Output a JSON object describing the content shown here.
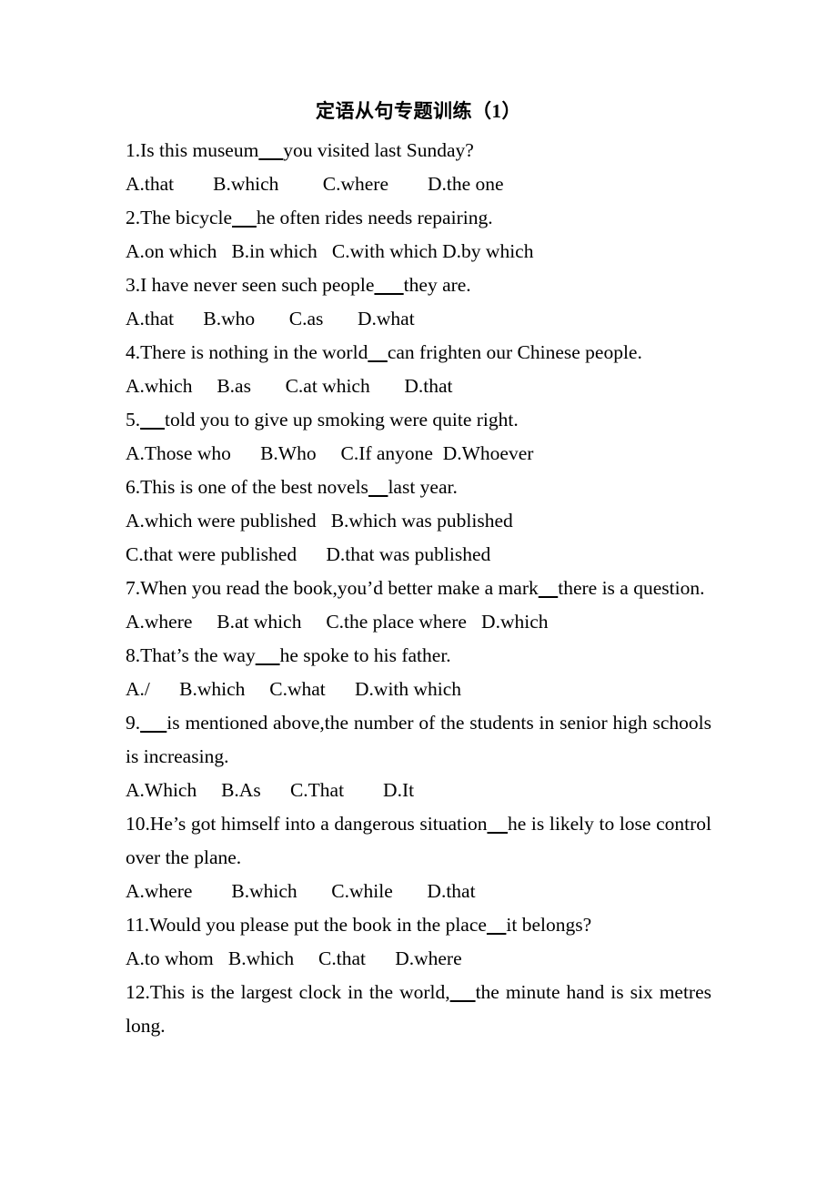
{
  "document": {
    "title": "定语从句专题训练（1）",
    "items": [
      {
        "id": "q1",
        "kind": "question",
        "justified": false,
        "text": "1.Is this museum_____you visited last Sunday?"
      },
      {
        "id": "q1-options",
        "kind": "options",
        "text": "A.that        B.which         C.where        D.the one"
      },
      {
        "id": "q2",
        "kind": "question",
        "justified": false,
        "text": "2.The bicycle_____he often rides needs repairing."
      },
      {
        "id": "q2-options",
        "kind": "options",
        "text": "A.on which   B.in which   C.with which D.by which"
      },
      {
        "id": "q3",
        "kind": "question",
        "justified": false,
        "text": "3.I have never seen such people______they are."
      },
      {
        "id": "q3-options",
        "kind": "options",
        "text": "A.that      B.who       C.as       D.what"
      },
      {
        "id": "q4",
        "kind": "question",
        "justified": false,
        "text": "4.There is nothing in the world____can frighten our Chinese people."
      },
      {
        "id": "q4-options",
        "kind": "options",
        "text": "A.which     B.as       C.at which       D.that"
      },
      {
        "id": "q5",
        "kind": "question",
        "justified": false,
        "text": "5._____told you to give up smoking were quite right."
      },
      {
        "id": "q5-options",
        "kind": "options",
        "text": "A.Those who      B.Who     C.If anyone  D.Whoever"
      },
      {
        "id": "q6",
        "kind": "question",
        "justified": false,
        "text": "6.This is one of the best novels____last year."
      },
      {
        "id": "q6-options-ab",
        "kind": "options",
        "text": "A.which were published   B.which was published"
      },
      {
        "id": "q6-options-cd",
        "kind": "options",
        "text": "C.that were published      D.that was published"
      },
      {
        "id": "q7",
        "kind": "question",
        "justified": true,
        "text": "7.When you read the book,you’d better make a mark____there is a question."
      },
      {
        "id": "q7-options",
        "kind": "options",
        "text": "A.where     B.at which     C.the place where   D.which"
      },
      {
        "id": "q8",
        "kind": "question",
        "justified": false,
        "text": "8.That’s the way_____he spoke to his father."
      },
      {
        "id": "q8-options",
        "kind": "options",
        "text": "A./      B.which     C.what      D.with which"
      },
      {
        "id": "q9",
        "kind": "question",
        "justified": true,
        "text": "9._____is mentioned above,the number of the students in senior high schools is increasing."
      },
      {
        "id": "q9-options",
        "kind": "options",
        "text": "A.Which     B.As      C.That        D.It"
      },
      {
        "id": "q10",
        "kind": "question",
        "justified": true,
        "text": "10.He’s got himself into a dangerous situation____he is likely to lose control over the plane."
      },
      {
        "id": "q10-options",
        "kind": "options",
        "text": "A.where        B.which       C.while       D.that"
      },
      {
        "id": "q11",
        "kind": "question",
        "justified": false,
        "text": "11.Would you please put the book in the place____it belongs?"
      },
      {
        "id": "q11-options",
        "kind": "options",
        "text": "A.to whom   B.which     C.that      D.where"
      },
      {
        "id": "q12",
        "kind": "question",
        "justified": true,
        "text": "12.This is the largest clock in the world,____the minute hand is six metres long."
      }
    ]
  }
}
